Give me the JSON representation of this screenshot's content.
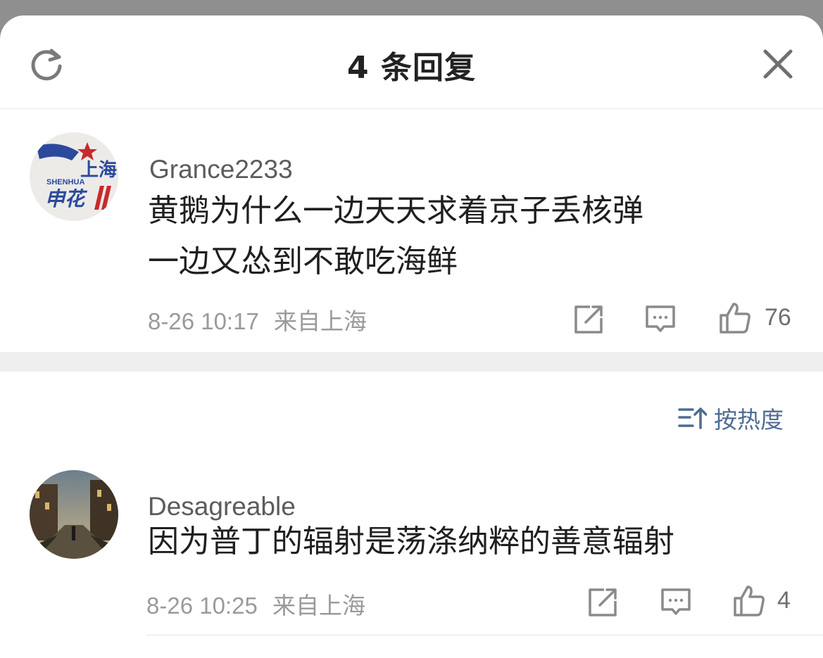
{
  "header": {
    "title": "4 条回复",
    "refresh_icon": "refresh-icon",
    "close_icon": "close-icon"
  },
  "main_comment": {
    "username": "Grance2233",
    "text_line1": "黄鹅为什么一边天天求着京子丢核弹",
    "text_line2": "一边又怂到不敢吃海鲜",
    "timestamp": "8-26 10:17",
    "location": "来自上海",
    "like_count": "76",
    "avatar_text": "上海",
    "avatar_subtext": "SHENHUA",
    "avatar_brand": "申花"
  },
  "sort": {
    "label": "按热度",
    "icon": "sort-icon"
  },
  "replies": [
    {
      "username": "Desagreable",
      "text": "因为普丁的辐射是荡涤纳粹的善意辐射",
      "timestamp": "8-26 10:25",
      "location": "来自上海",
      "like_count": "4"
    }
  ],
  "colors": {
    "backdrop": "#8f8f8f",
    "sheet": "#ffffff",
    "sort_accent": "#4f6c92",
    "meta_text": "#9a9a9a"
  }
}
